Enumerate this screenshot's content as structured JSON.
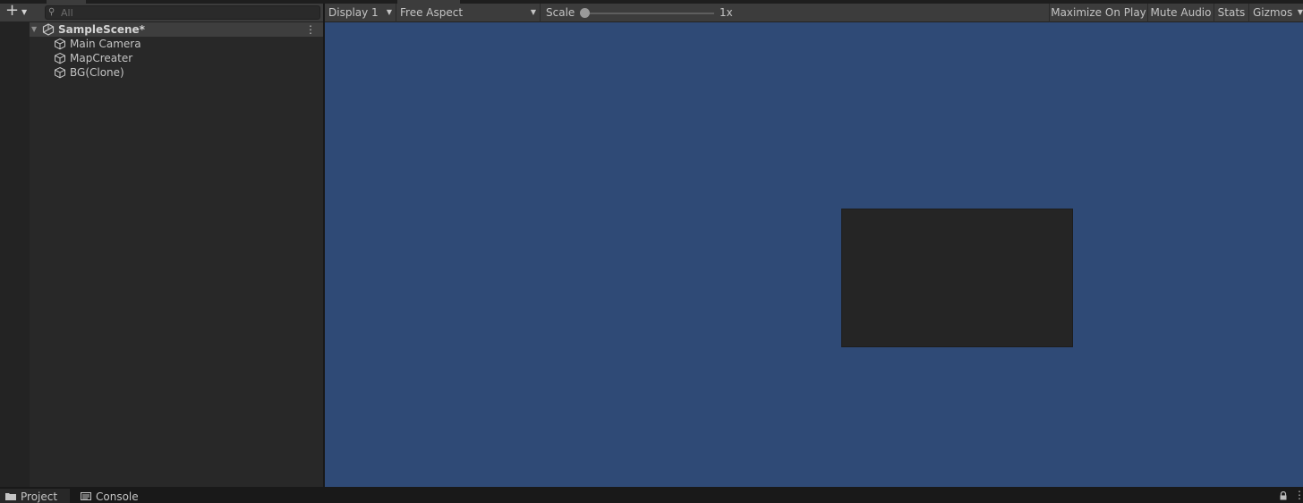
{
  "hierarchy": {
    "search_placeholder": "All",
    "scene": {
      "name": "SampleScene*"
    },
    "objects": [
      {
        "label": "Main Camera"
      },
      {
        "label": "MapCreater"
      },
      {
        "label": "BG(Clone)"
      }
    ]
  },
  "game_toolbar": {
    "display": "Display 1",
    "aspect": "Free Aspect",
    "scale_label": "Scale",
    "scale_value": "1x",
    "maximize_on_play": "Maximize On Play",
    "mute_audio": "Mute Audio",
    "stats": "Stats",
    "gizmos": "Gizmos"
  },
  "bottom_tabs": [
    {
      "label": "Project",
      "icon": "folder-icon"
    },
    {
      "label": "Console",
      "icon": "console-icon"
    }
  ],
  "colors": {
    "game_background": "#2f4a76",
    "panel": "#282828",
    "toolbar": "#3c3c3c",
    "game_object": "#252525"
  }
}
